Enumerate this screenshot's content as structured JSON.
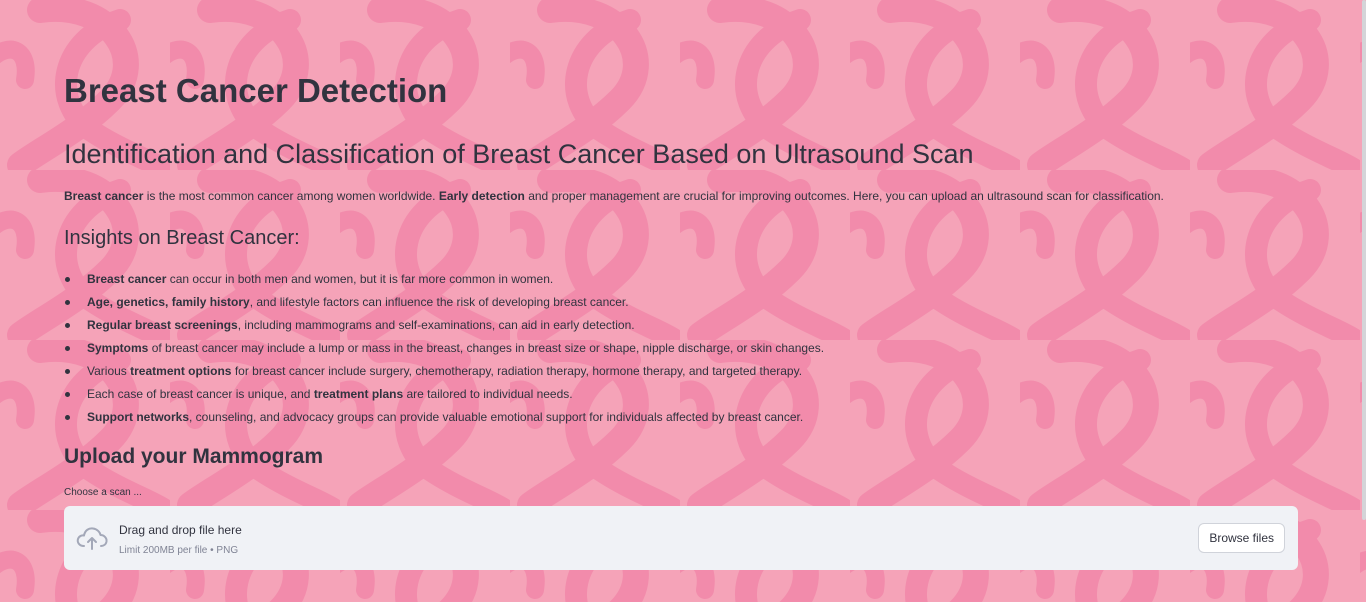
{
  "colors": {
    "background": "#f5a3b8",
    "ribbon": "#f07ea3",
    "text": "#31333f",
    "dropzone": "#f0f2f6",
    "muted_text": "#808495"
  },
  "header": {
    "title": "Breast Cancer Detection",
    "subtitle": "Identification and Classification of Breast Cancer Based on Ultrasound Scan"
  },
  "intro": {
    "bold1": "Breast cancer",
    "text1": " is the most common cancer among women worldwide. ",
    "bold2": "Early detection",
    "text2": " and proper management are crucial for improving outcomes. Here, you can upload an ultrasound scan for classification."
  },
  "insights": {
    "heading": "Insights on Breast Cancer:",
    "items": [
      {
        "pre": "",
        "bold": "Breast cancer",
        "post": " can occur in both men and women, but it is far more common in women."
      },
      {
        "pre": "",
        "bold": "Age, genetics, family history",
        "post": ", and lifestyle factors can influence the risk of developing breast cancer."
      },
      {
        "pre": "",
        "bold": "Regular breast screenings",
        "post": ", including mammograms and self-examinations, can aid in early detection."
      },
      {
        "pre": "",
        "bold": "Symptoms",
        "post": " of breast cancer may include a lump or mass in the breast, changes in breast size or shape, nipple discharge, or skin changes."
      },
      {
        "pre": "Various ",
        "bold": "treatment options",
        "post": " for breast cancer include surgery, chemotherapy, radiation therapy, hormone therapy, and targeted therapy."
      },
      {
        "pre": "Each case of breast cancer is unique, and ",
        "bold": "treatment plans",
        "post": " are tailored to individual needs."
      },
      {
        "pre": "",
        "bold": "Support networks",
        "post": ", counseling, and advocacy groups can provide valuable emotional support for individuals affected by breast cancer."
      }
    ]
  },
  "upload": {
    "heading": "Upload your Mammogram",
    "label": "Choose a scan ...",
    "dropzone_title": "Drag and drop file here",
    "dropzone_limit": "Limit 200MB per file • PNG",
    "browse_label": "Browse files",
    "icon": "cloud-upload-icon"
  }
}
